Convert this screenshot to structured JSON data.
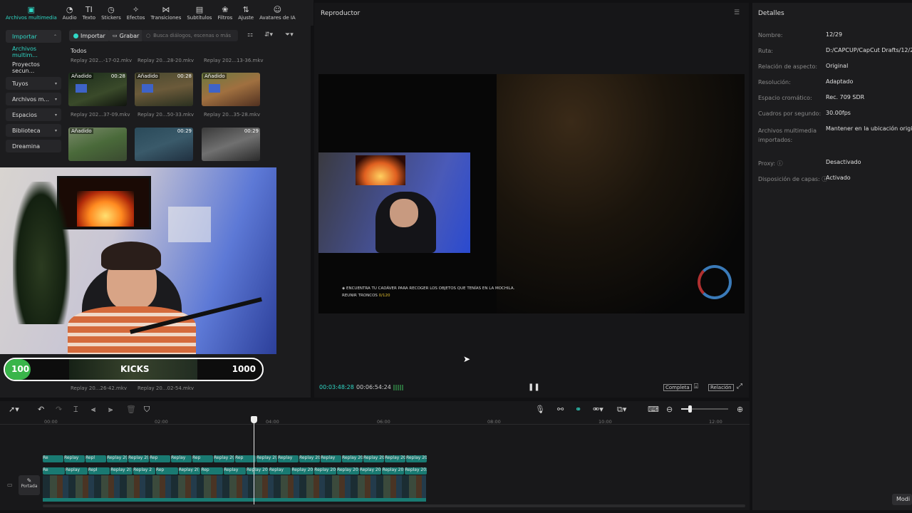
{
  "toolbar": {
    "tools": [
      {
        "label": "Archivos multimedia",
        "icon": "media-icon",
        "active": true
      },
      {
        "label": "Audio",
        "icon": "audio-icon"
      },
      {
        "label": "Texto",
        "icon": "text-icon"
      },
      {
        "label": "Stickers",
        "icon": "stickers-icon"
      },
      {
        "label": "Efectos",
        "icon": "effects-icon"
      },
      {
        "label": "Transiciones",
        "icon": "transitions-icon"
      },
      {
        "label": "Subtítulos",
        "icon": "subtitles-icon"
      },
      {
        "label": "Filtros",
        "icon": "filters-icon"
      },
      {
        "label": "Ajuste",
        "icon": "adjust-icon"
      },
      {
        "label": "Avatares de IA",
        "icon": "ai-avatar-icon"
      }
    ]
  },
  "sidebar": {
    "items": [
      {
        "label": "Importar",
        "chevron": true
      },
      {
        "label": "Archivos multim..."
      },
      {
        "label": "Proyectos secun..."
      },
      {
        "label": "Tuyos",
        "chevron": true
      },
      {
        "label": "Archivos m...",
        "chevron": true
      },
      {
        "label": "Espacios",
        "chevron": true
      },
      {
        "label": "Biblioteca",
        "chevron": true
      },
      {
        "label": "Dreamina"
      }
    ]
  },
  "media": {
    "import_label": "Importar",
    "record_label": "Grabar",
    "search_placeholder": "Busca diálogos, escenas o más",
    "section_label": "Todos",
    "top_names": [
      "Replay 202...-17-02.mkv",
      "Replay 20...28-20.mkv",
      "Replay 202...13-36.mkv"
    ],
    "row1": [
      {
        "badge": "Añadido",
        "duration": "00:28",
        "name": "Replay 202...37-09.mkv"
      },
      {
        "badge": "Añadido",
        "duration": "00:28",
        "name": "Replay 20...50-33.mkv"
      },
      {
        "badge": "Añadido",
        "duration": "",
        "name": "Replay 20...35-28.mkv"
      }
    ],
    "row2": [
      {
        "badge": "Añadido",
        "duration": ""
      },
      {
        "badge": "",
        "duration": "00:29"
      },
      {
        "badge": "",
        "duration": "00:29"
      }
    ],
    "bottom_names": [
      "Replay 20...26-42.mkv",
      "Replay 20...02-54.mkv"
    ]
  },
  "overlay": {
    "kicks_left": "100",
    "kicks_label": "KICKS",
    "kicks_right": "1000",
    "kicks_progress": 0.1
  },
  "player": {
    "title": "Reproductor",
    "current_time": "00:03:48:28",
    "total_time": "00:06:54:24",
    "hud_line1": "ENCUENTRA TU CADÁVER PARA RECOGER LOS OBJETOS QUE TENÍAS EN LA MOCHILA.",
    "hud_line2_label": "REUNIR TRONCOS",
    "hud_line2_value": "0/120",
    "full_label": "Completa",
    "ratio_label": "Relación"
  },
  "details": {
    "title": "Detalles",
    "rows": [
      {
        "label": "Nombre:",
        "value": "12/29"
      },
      {
        "label": "Ruta:",
        "value": "D:/CAPCUP/CapCut Drafts/12/29"
      },
      {
        "label": "Relación de aspecto:",
        "value": "Original"
      },
      {
        "label": "Resolución:",
        "value": "Adaptado"
      },
      {
        "label": "Espacio cromático:",
        "value": "Rec. 709 SDR"
      },
      {
        "label": "Cuadros por segundo:",
        "value": "30.00fps"
      },
      {
        "label": "Archivos multimedia importados:",
        "value": "Mantener en la ubicación origina"
      },
      {
        "label": "Proxy:",
        "value": "Desactivado"
      },
      {
        "label": "Disposición de capas:",
        "value": "Activado"
      }
    ],
    "modify_label": "Modi"
  },
  "timeline": {
    "ticks": [
      "00:00",
      "02:00",
      "04:00",
      "06:00",
      "08:00",
      "10:00",
      "12:00"
    ],
    "cover_label": "Portada",
    "audio_clips": [
      "Re",
      "Replay",
      "Repl",
      "Replay 2(",
      "Replay 2(",
      "Rep",
      "Replay",
      "Rep",
      "Replay 2(",
      "Rep",
      "Replay 2(",
      "Replay",
      "Replay 20",
      "Replay",
      "Replay 20",
      "Replay 20",
      "Replay 20",
      "Replay 20"
    ],
    "video_clips": [
      "Re",
      "Replay",
      "Repl",
      "Replay 2(",
      "Replay 2",
      "Rep",
      "Replay 2(",
      "Rep",
      "Replay",
      "Replay 20",
      "Replay",
      "Replay 20",
      "Replay 20",
      "Replay 20",
      "Replay 20",
      "Replay 20",
      "Replay 202"
    ]
  },
  "colors": {
    "accent": "#2fd8c6",
    "clip": "#197a72",
    "kicks_green": "#39b54a"
  }
}
